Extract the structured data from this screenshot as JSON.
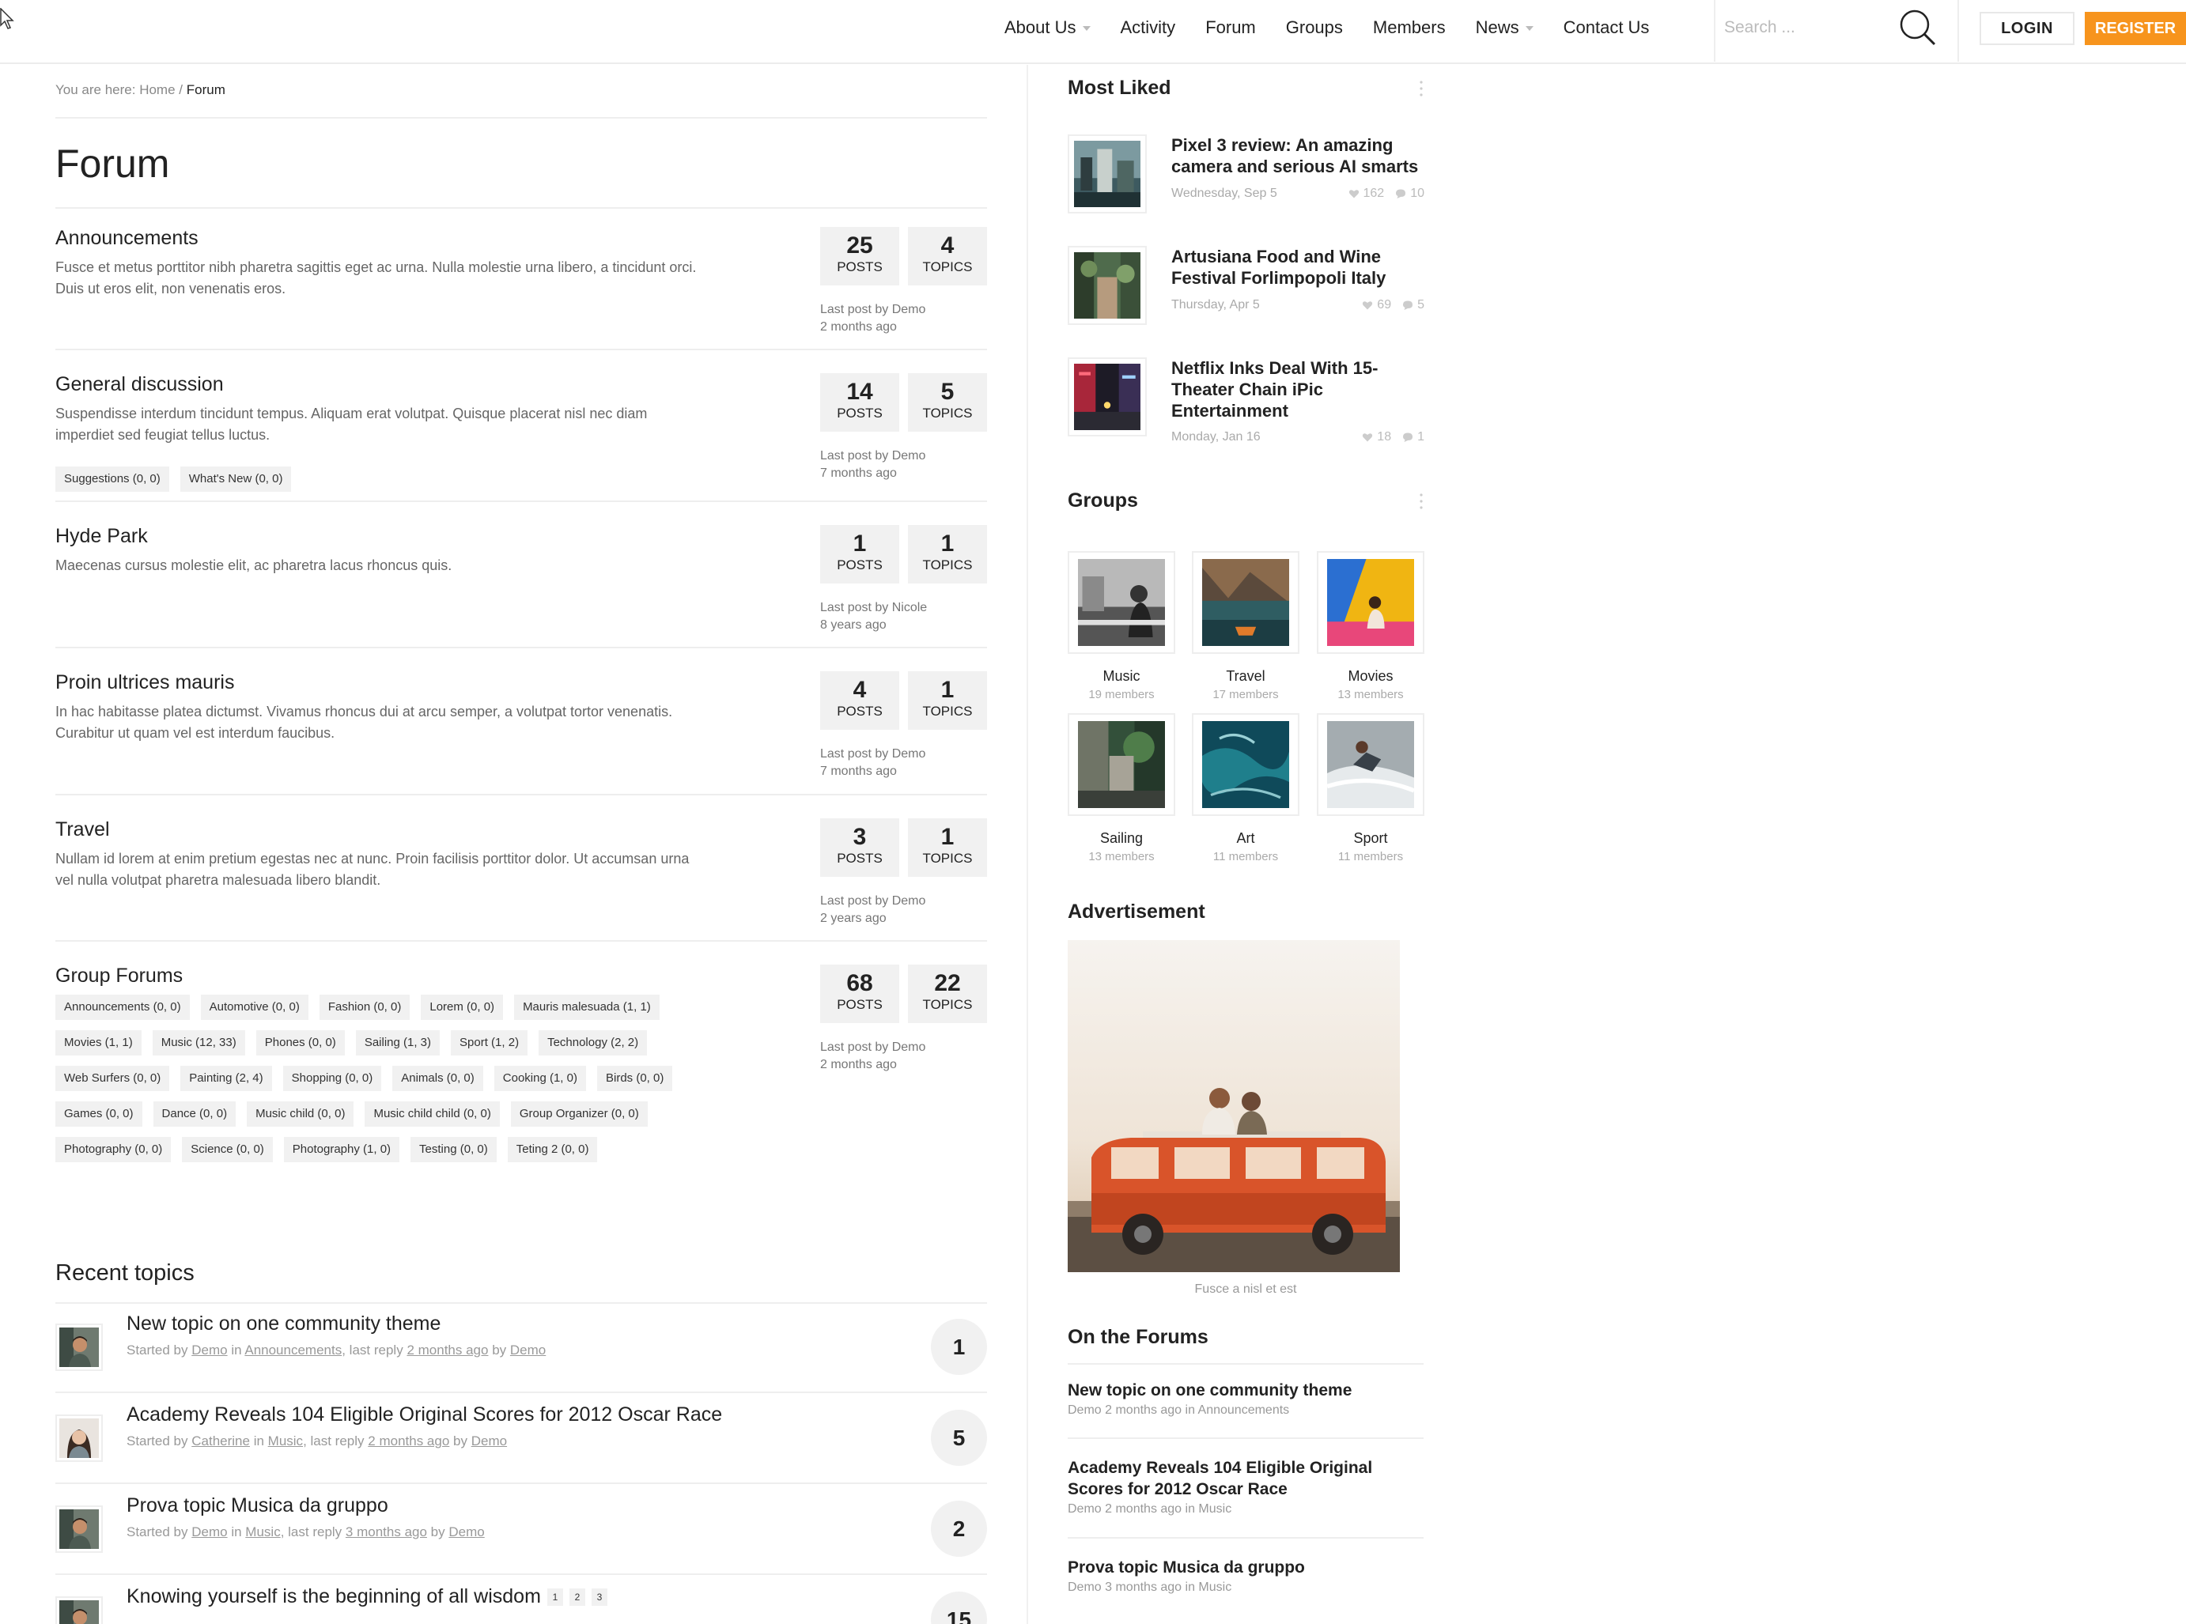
{
  "nav": {
    "items": [
      {
        "label": "About Us",
        "dropdown": true
      },
      {
        "label": "Activity",
        "dropdown": false
      },
      {
        "label": "Forum",
        "dropdown": false
      },
      {
        "label": "Groups",
        "dropdown": false
      },
      {
        "label": "Members",
        "dropdown": false
      },
      {
        "label": "News",
        "dropdown": true
      },
      {
        "label": "Contact Us",
        "dropdown": false
      }
    ],
    "search_placeholder": "Search ...",
    "login_label": "LOGIN",
    "register_label": "REGISTER",
    "accent_color": "#f7941d"
  },
  "breadcrumb": {
    "prefix": "You are here:",
    "home": "Home",
    "separator": "/",
    "current": "Forum"
  },
  "page_title": "Forum",
  "forums": [
    {
      "title": "Announcements",
      "desc": "Fusce et metus porttitor nibh pharetra sagittis eget ac urna. Nulla molestie urna libero, a tincidunt orci. Duis ut eros elit, non venenatis eros.",
      "posts": "25",
      "topics": "4",
      "last_by": "Last post by Demo",
      "last_when": "2 months ago",
      "tags": []
    },
    {
      "title": "General discussion",
      "desc": "Suspendisse interdum tincidunt tempus. Aliquam erat volutpat. Quisque placerat nisl nec diam imperdiet sed feugiat tellus luctus.",
      "posts": "14",
      "topics": "5",
      "last_by": "Last post by Demo",
      "last_when": "7 months ago",
      "tags": [
        "Suggestions (0, 0)",
        "What's New (0, 0)"
      ]
    },
    {
      "title": "Hyde Park",
      "desc": "Maecenas cursus molestie elit, ac pharetra lacus rhoncus quis.",
      "posts": "1",
      "topics": "1",
      "last_by": "Last post by Nicole",
      "last_when": "8 years ago",
      "tags": []
    },
    {
      "title": "Proin ultrices mauris",
      "desc": "In hac habitasse platea dictumst. Vivamus rhoncus dui at arcu semper, a volutpat tortor venenatis. Curabitur ut quam vel est interdum faucibus.",
      "posts": "4",
      "topics": "1",
      "last_by": "Last post by Demo",
      "last_when": "7 months ago",
      "tags": []
    },
    {
      "title": "Travel",
      "desc": "Nullam id lorem at enim pretium egestas nec at nunc. Proin facilisis porttitor dolor. Ut accumsan urna vel nulla volutpat pharetra malesuada libero blandit.",
      "posts": "3",
      "topics": "1",
      "last_by": "Last post by Demo",
      "last_when": "2 years ago",
      "tags": []
    },
    {
      "title": "Group Forums",
      "desc": "",
      "posts": "68",
      "topics": "22",
      "last_by": "Last post by Demo",
      "last_when": "2 months ago",
      "tags": [
        "Announcements (0, 0)",
        "Automotive (0, 0)",
        "Fashion (0, 0)",
        "Lorem (0, 0)",
        "Mauris malesuada (1, 1)",
        "Movies (1, 1)",
        "Music (12, 33)",
        "Phones (0, 0)",
        "Sailing (1, 3)",
        "Sport (1, 2)",
        "Technology (2, 2)",
        "Web Surfers (0, 0)",
        "Painting (2, 4)",
        "Shopping (0, 0)",
        "Animals (0, 0)",
        "Cooking (1, 0)",
        "Birds (0, 0)",
        "Games (0, 0)",
        "Dance (0, 0)",
        "Music child (0, 0)",
        "Music child child (0, 0)",
        "Group Organizer (0, 0)",
        "Photography (0, 0)",
        "Science (0, 0)",
        "Photography (1, 0)",
        "Testing (0, 0)",
        "Teting 2 (0, 0)"
      ]
    }
  ],
  "stat_labels": {
    "posts": "POSTS",
    "topics": "TOPICS"
  },
  "recent": {
    "title": "Recent topics",
    "topics": [
      {
        "title": "New topic on one community theme",
        "started": "Started by",
        "author": "Demo",
        "in": "in",
        "forum": "Announcements",
        "last_reply": ", last reply",
        "when": "2 months ago",
        "by": "by",
        "reply_by": "Demo",
        "count": "1",
        "pages": []
      },
      {
        "title": "Academy Reveals 104 Eligible Original Scores for 2012 Oscar Race",
        "started": "Started by",
        "author": "Catherine",
        "in": "in",
        "forum": "Music",
        "last_reply": ", last reply",
        "when": "2 months ago",
        "by": "by",
        "reply_by": "Demo",
        "count": "5",
        "pages": []
      },
      {
        "title": "Prova topic Musica da gruppo",
        "started": "Started by",
        "author": "Demo",
        "in": "in",
        "forum": "Music",
        "last_reply": ", last reply",
        "when": "3 months ago",
        "by": "by",
        "reply_by": "Demo",
        "count": "2",
        "pages": []
      },
      {
        "title": "Knowing yourself is the beginning of all wisdom",
        "started": "",
        "author": "",
        "in": "",
        "forum": "",
        "last_reply": "",
        "when": "",
        "by": "",
        "reply_by": "",
        "count": "15",
        "pages": [
          "1",
          "2",
          "3"
        ]
      }
    ]
  },
  "sidebar": {
    "most_liked": {
      "title": "Most Liked",
      "items": [
        {
          "title": "Pixel 3 review: An amazing camera and serious AI smarts",
          "date": "Wednesday, Sep 5",
          "likes": "162",
          "comments": "10"
        },
        {
          "title": "Artusiana Food and Wine Festival Forlimpopoli Italy",
          "date": "Thursday, Apr 5",
          "likes": "69",
          "comments": "5"
        },
        {
          "title": "Netflix Inks Deal With 15-Theater Chain iPic Entertainment",
          "date": "Monday, Jan 16",
          "likes": "18",
          "comments": "1"
        }
      ]
    },
    "groups": {
      "title": "Groups",
      "items": [
        {
          "name": "Music",
          "members": "19 members"
        },
        {
          "name": "Travel",
          "members": "17 members"
        },
        {
          "name": "Movies",
          "members": "13 members"
        },
        {
          "name": "Sailing",
          "members": "13 members"
        },
        {
          "name": "Art",
          "members": "11 members"
        },
        {
          "name": "Sport",
          "members": "11 members"
        }
      ]
    },
    "ad": {
      "title": "Advertisement",
      "caption": "Fusce a nisl et est"
    },
    "on_forums": {
      "title": "On the Forums",
      "items": [
        {
          "title": "New topic on one community theme",
          "meta": "Demo 2 months ago in Announcements"
        },
        {
          "title": "Academy Reveals 104 Eligible Original Scores for 2012 Oscar Race",
          "meta": "Demo 2 months ago in Music"
        },
        {
          "title": "Prova topic Musica da gruppo",
          "meta": "Demo 3 months ago in Music"
        }
      ]
    }
  }
}
